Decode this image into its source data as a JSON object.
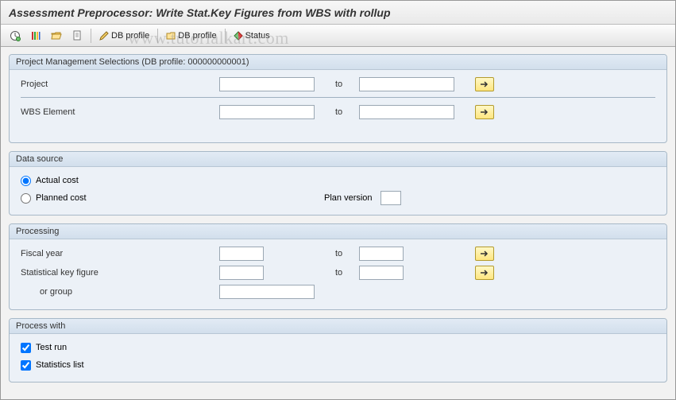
{
  "title": "Assessment Preprocessor: Write Stat.Key Figures from WBS with rollup",
  "toolbar": {
    "execute": "",
    "db_profile_edit": "DB profile",
    "db_profile_choose": "DB profile",
    "status": "Status"
  },
  "watermark": "www.tutorialkart.com",
  "groups": {
    "pm": {
      "title": "Project Management Selections (DB profile: 000000000001)",
      "project_label": "Project",
      "project_from": "",
      "project_to": "",
      "wbs_label": "WBS Element",
      "wbs_from": "",
      "wbs_to": "",
      "to_label": "to"
    },
    "ds": {
      "title": "Data source",
      "actual_label": "Actual cost",
      "planned_label": "Planned cost",
      "selected": "actual",
      "plan_version_label": "Plan version",
      "plan_version": ""
    },
    "proc": {
      "title": "Processing",
      "fiscal_label": "Fiscal year",
      "fiscal_from": "",
      "fiscal_to": "",
      "skf_label": "Statistical key figure",
      "skf_from": "",
      "skf_to": "",
      "group_label": "or group",
      "group": "",
      "to_label": "to"
    },
    "pw": {
      "title": "Process with",
      "test_run_label": "Test run",
      "test_run": true,
      "stats_list_label": "Statistics list",
      "stats_list": true
    }
  }
}
